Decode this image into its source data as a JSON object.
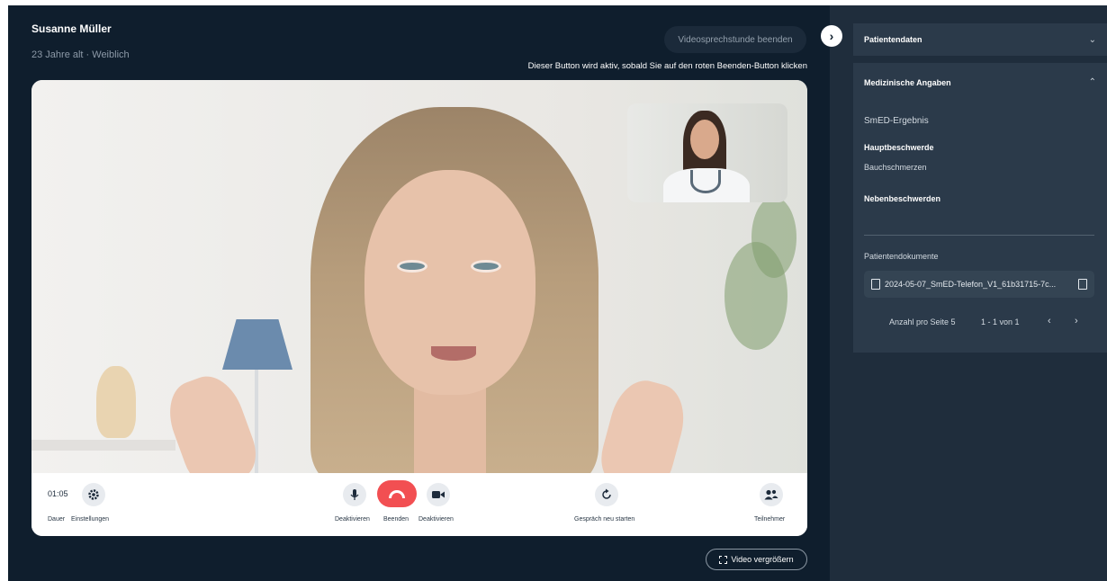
{
  "patient": {
    "name": "Susanne Müller",
    "meta": "23 Jahre alt · Weiblich"
  },
  "header": {
    "end_consult_label": "Videosprechstunde beenden",
    "hint": "Dieser Button wird aktiv, sobald Sie auf den roten Beenden-Button klicken"
  },
  "controls": {
    "duration_value": "01:05",
    "duration_label": "Dauer",
    "settings_label": "Einstellungen",
    "mic_label": "Deaktivieren",
    "end_label": "Beenden",
    "camera_label": "Deaktivieren",
    "restart_label": "Gespräch neu starten",
    "participants_label": "Teilnehmer",
    "hangup_color": "#f24f52"
  },
  "enlarge_label": "Video vergrößern",
  "sidebar": {
    "patient_data_label": "Patientendaten",
    "medical_label": "Medizinische Angaben",
    "smed_result": "SmED-Ergebnis",
    "main_complaint_label": "Hauptbeschwerde",
    "main_complaint_value": "Bauchschmerzen",
    "side_complaints_label": "Nebenbeschwerden",
    "documents_label": "Patientendokumente",
    "document_name": "2024-05-07_SmED-Telefon_V1_61b31715-7c...",
    "per_page": "Anzahl pro Seite 5",
    "range": "1 - 1 von 1"
  },
  "icons": {
    "settings": "gear-icon",
    "mic": "microphone-icon",
    "hangup": "phone-hangup-icon",
    "camera": "video-camera-icon",
    "restart": "restart-icon",
    "participants": "participants-icon",
    "collapse": "chevron-right-icon",
    "enlarge": "expand-icon",
    "document": "file-icon"
  }
}
